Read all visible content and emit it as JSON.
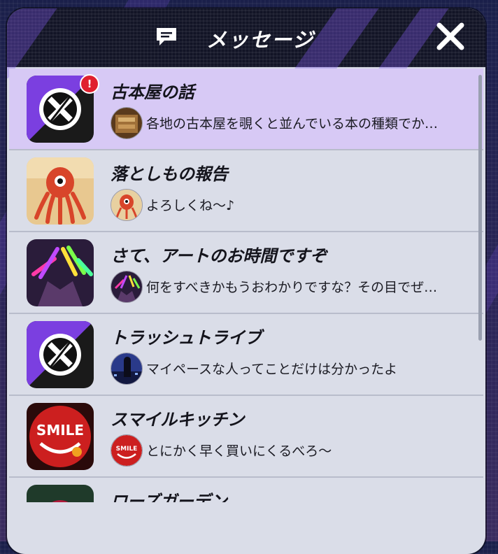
{
  "header": {
    "title": "メッセージ"
  },
  "messages": [
    {
      "title": "古本屋の話",
      "preview": "各地の古本屋を覗くと並んでいる本の種類でか…",
      "unread": true,
      "badge": "!",
      "icon": "trash-tribe-icon",
      "sender_icon": "book-portrait-icon"
    },
    {
      "title": "落としもの報告",
      "preview": "よろしくね～♪",
      "unread": false,
      "icon": "octopus-icon",
      "sender_icon": "octopus-icon"
    },
    {
      "title": "さて、アートのお時間ですぞ",
      "preview": "何をすべきかもうおわかりですな？その目でぜ…",
      "unread": false,
      "icon": "glowstick-hands-icon",
      "sender_icon": "glowstick-hands-icon"
    },
    {
      "title": "トラッシュトライブ",
      "preview": "マイペースな人ってことだけは分かったよ",
      "unread": false,
      "icon": "trash-tribe-icon",
      "sender_icon": "night-city-icon"
    },
    {
      "title": "スマイルキッチン",
      "preview": "とにかく早く買いにくるべろ～",
      "unread": false,
      "icon": "smile-kitchen-icon",
      "sender_icon": "smile-kitchen-icon"
    },
    {
      "title": "ローズガーデン",
      "preview": "",
      "unread": false,
      "icon": "rose-icon",
      "sender_icon": ""
    }
  ],
  "icon_text": {
    "smile": "SMILE"
  },
  "colors": {
    "unread_row": "#d7c9f5",
    "row": "#dadde8",
    "badge": "#e0202e",
    "header": "#121426"
  }
}
